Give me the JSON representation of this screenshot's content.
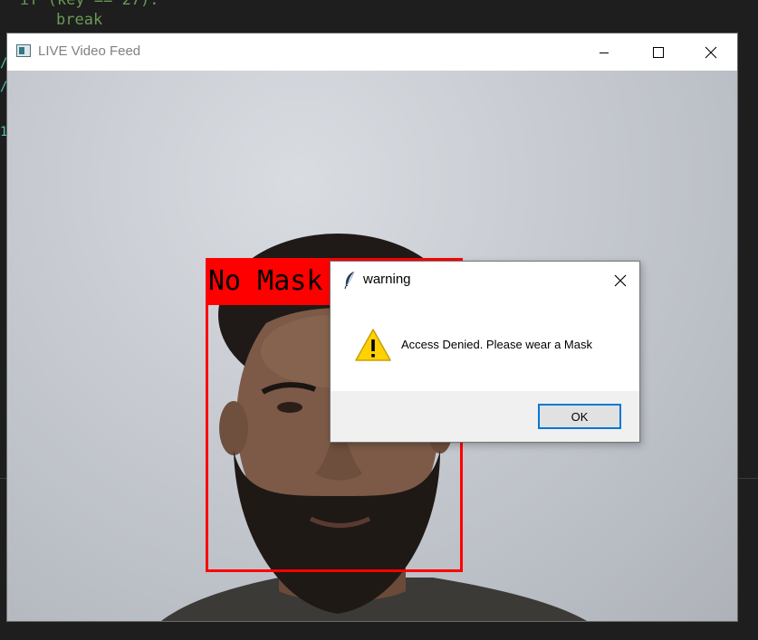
{
  "editor": {
    "code_lines": [
      "if (key == 27):",
      "break"
    ],
    "edge_marks": [
      "/",
      "/",
      "1"
    ]
  },
  "window": {
    "title": "LIVE Video Feed",
    "icon": "app-icon",
    "controls": [
      "minimize-icon",
      "maximize-icon",
      "close-icon"
    ]
  },
  "video": {
    "detection_label": "No Mask",
    "box_color": "#ff0000"
  },
  "dialog": {
    "title": "warning",
    "title_icon": "feather-icon",
    "message": "Access Denied. Please wear a Mask",
    "icon": "warning-icon",
    "ok_label": "OK",
    "accent": "#0078d7"
  }
}
